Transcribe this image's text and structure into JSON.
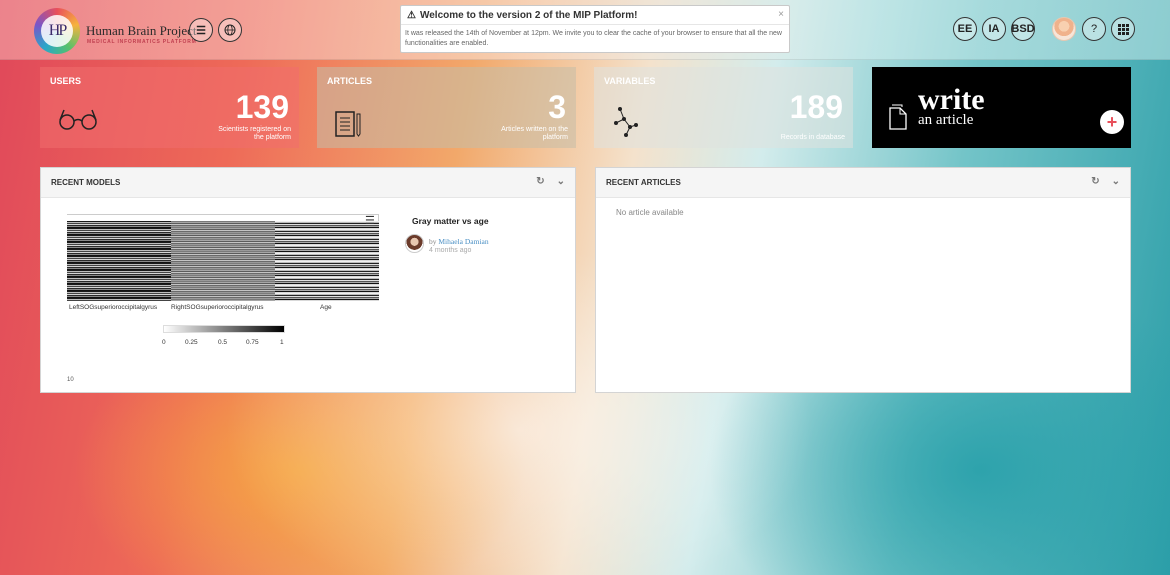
{
  "header": {
    "logo_text": "HP",
    "brand_title": "Human Brain Project",
    "brand_subtitle": "MEDICAL INFORMATICS PLATFORM",
    "user_buttons": [
      "EE",
      "IA",
      "BSD"
    ],
    "help_label": "?"
  },
  "notification": {
    "title": "Welcome to the version 2 of the MIP Platform!",
    "body": "It was released the 14th of November at 12pm. We invite you to clear the cache of your browser to ensure that all the new functionalities are enabled.",
    "close": "×"
  },
  "stats": {
    "users": {
      "title": "USERS",
      "count": "139",
      "caption": "Scientists registered on the platform"
    },
    "articles": {
      "title": "ARTICLES",
      "count": "3",
      "caption": "Articles written on the platform"
    },
    "variables": {
      "title": "VARIABLES",
      "count": "189",
      "caption": "Records in database"
    },
    "write": {
      "big": "write",
      "small": "an article",
      "plus": "+"
    }
  },
  "recent_models": {
    "title": "RECENT MODELS",
    "model": {
      "name": "Gray matter vs age",
      "by": "by",
      "author": "Mihaela Damian",
      "time": "4 months ago"
    },
    "heatmap": {
      "columns": [
        "LeftSOGsuperioroccipitalgyrus",
        "RightSOGsuperioroccipitalgyrus",
        "Age"
      ],
      "scale_ticks": [
        "0",
        "0.25",
        "0.5",
        "0.75",
        "1"
      ],
      "cut_label": "10"
    }
  },
  "recent_articles": {
    "title": "RECENT ARTICLES",
    "empty": "No article available"
  },
  "colors": {
    "write_bg": "#000000",
    "plus_accent": "#e8505b",
    "link": "#4a8fc4"
  }
}
